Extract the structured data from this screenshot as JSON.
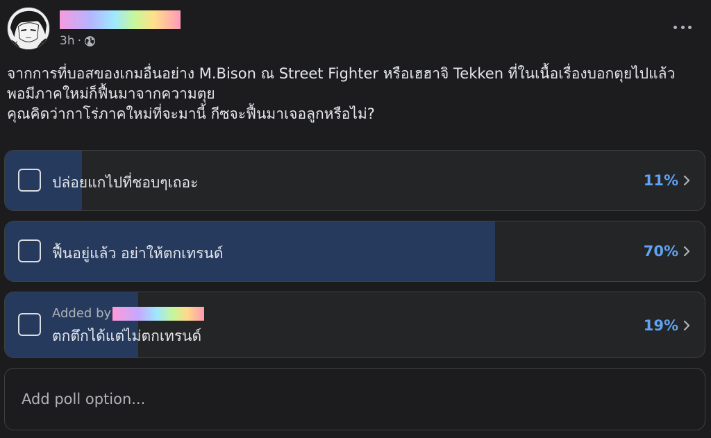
{
  "post": {
    "time": "3h",
    "dot": "·",
    "privacy_icon": "globe-icon",
    "more_icon": "more-horizontal-icon",
    "text_lines": [
      "จากการที่บอสของเกมอื่นอย่าง M.Bison ณ Street Fighter หรือเฮฮาจิ Tekken ที่ในเนื้อเรื่องบอกตุยไปแล้ว",
      "พอมีภาคใหม่ก็ฟื้นมาจากความตุย",
      "คุณคิดว่ากาโร่ภาคใหม่ที่จะมานี้ กีซจะฟื้นมาเจอลูกหรือไม่?"
    ]
  },
  "poll": {
    "options": [
      {
        "label": "ปล่อยแกไปที่ชอบๆเถอะ",
        "percent_label": "11%",
        "percent": 11
      },
      {
        "label": "ฟื้นอยู่แล้ว อย่าให้ตกเทรนด์",
        "percent_label": "70%",
        "percent": 70
      },
      {
        "added_by": "Added by",
        "label": "ตกตึกได้แต่ไม่ตกเทรนด์",
        "percent_label": "19%",
        "percent": 19
      }
    ],
    "add_placeholder": "Add poll option..."
  },
  "colors": {
    "background": "#1c1c1e",
    "fill": "#263a5e",
    "percent": "#5fa3f2"
  }
}
